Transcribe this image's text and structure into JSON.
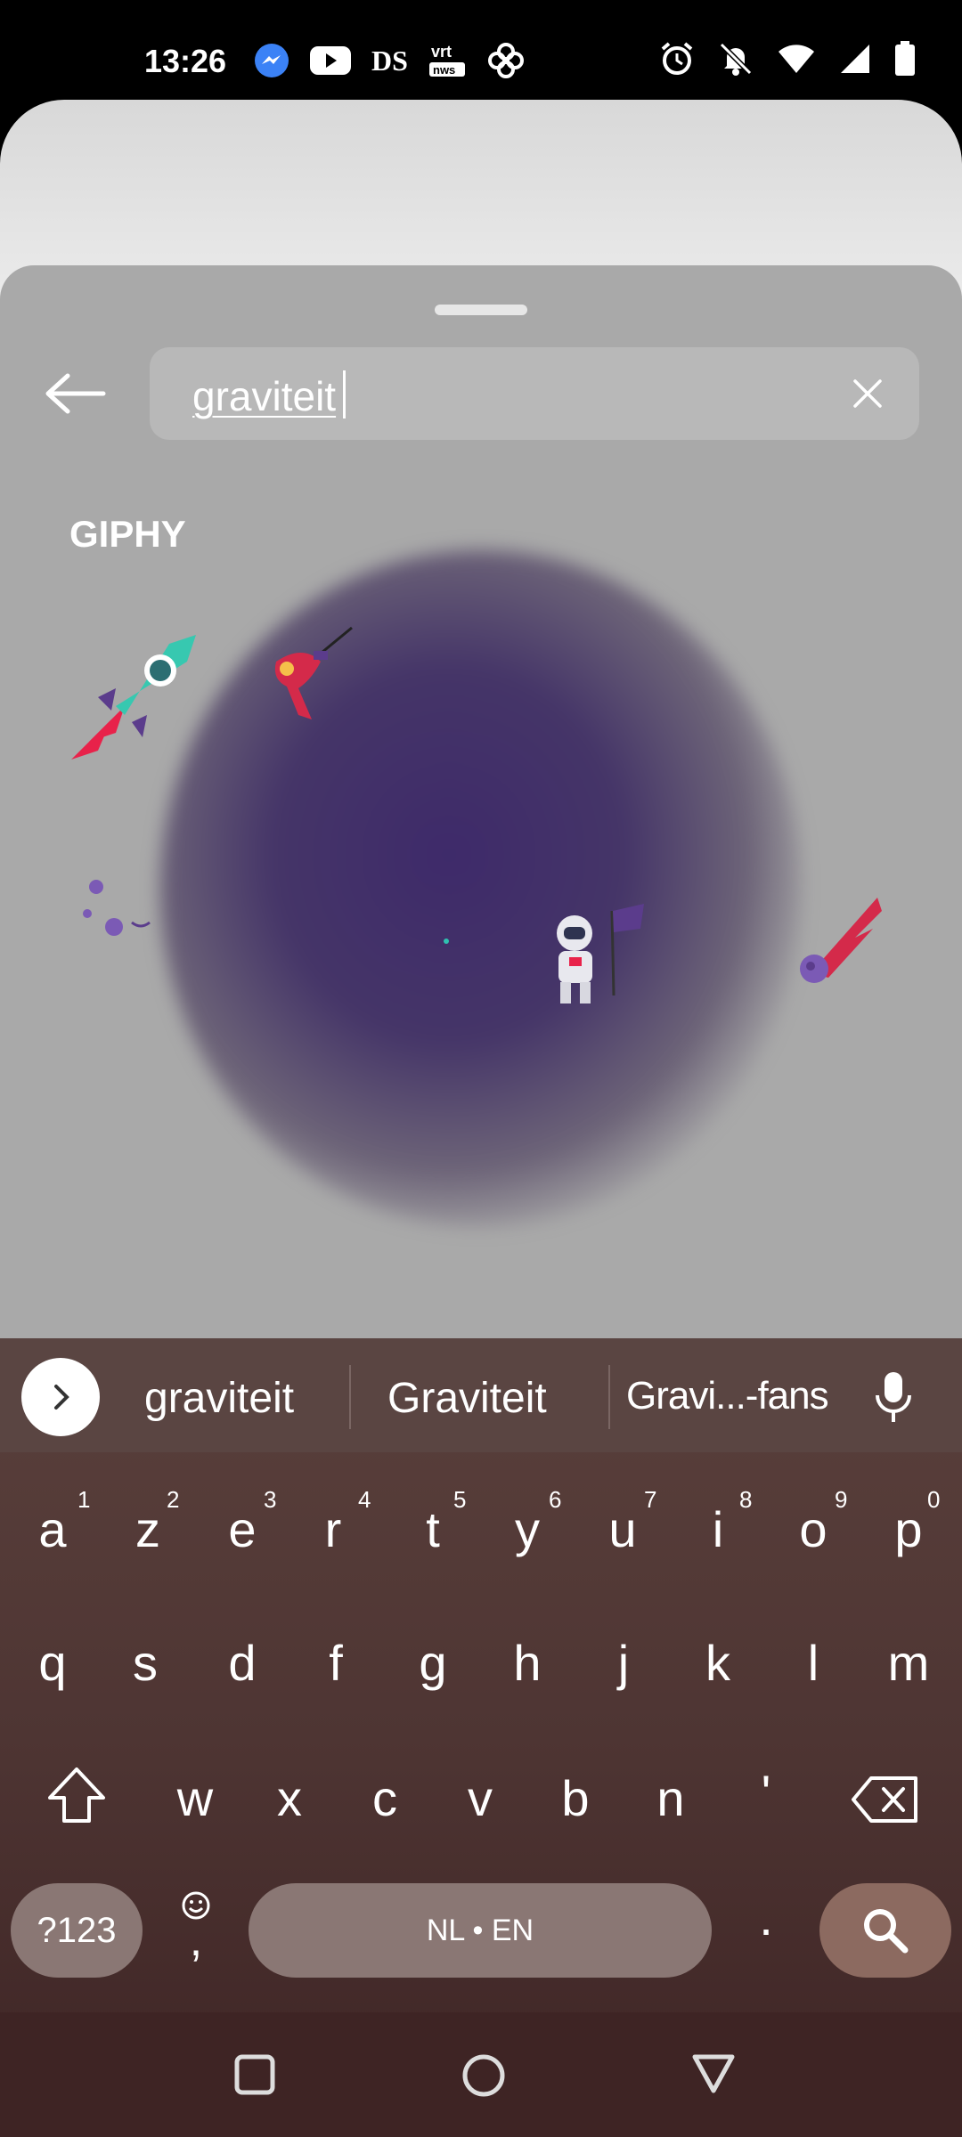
{
  "status_bar": {
    "time": "13:26",
    "ds_label": "DS",
    "notification_icons": [
      "messenger-icon",
      "youtube-icon",
      "ds-icon",
      "vrt-nws-icon",
      "pinwheel-icon"
    ],
    "system_icons": [
      "alarm-icon",
      "notifications-off-icon",
      "wifi-icon",
      "signal-icon",
      "battery-icon"
    ]
  },
  "search": {
    "query": "graviteit"
  },
  "results": {
    "section_label": "GIPHY",
    "stickers": [
      "rocket-sticker",
      "ray-gun-sticker",
      "dot-sticker",
      "astronaut-flag-sticker",
      "comet-sticker",
      "moon-sticker"
    ]
  },
  "keyboard": {
    "suggestions": [
      "graviteit",
      "Graviteit",
      "Gravi...-fans"
    ],
    "row1": [
      "a",
      "z",
      "e",
      "r",
      "t",
      "y",
      "u",
      "i",
      "o",
      "p"
    ],
    "row1_hints": [
      "1",
      "2",
      "3",
      "4",
      "5",
      "6",
      "7",
      "8",
      "9",
      "0"
    ],
    "row2": [
      "q",
      "s",
      "d",
      "f",
      "g",
      "h",
      "j",
      "k",
      "l",
      "m"
    ],
    "row3": [
      "w",
      "x",
      "c",
      "v",
      "b",
      "n",
      "'"
    ],
    "symbols_label": "?123",
    "comma": ",",
    "space_label": "NL • EN",
    "period": "."
  },
  "colors": {
    "sheet": "#a9a9a9",
    "keyboard": "#4e3533",
    "search_key": "#8c6a60"
  }
}
